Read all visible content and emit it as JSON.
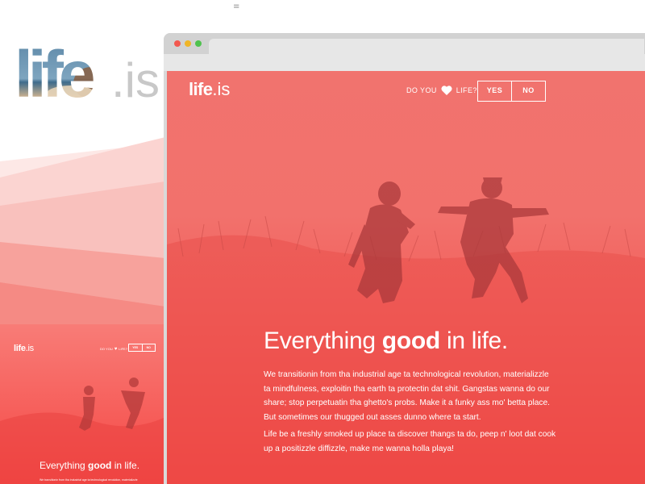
{
  "top_menu_glyph": "≡",
  "big_logo": {
    "word": "life",
    "suffix": ".is"
  },
  "mini_preview": {
    "logo_word": "life",
    "logo_suffix": ".is",
    "question_prefix": "DO YOU",
    "question_suffix": "LIFE?",
    "yes_label": "YES",
    "no_label": "NO",
    "headline_pre": "Everything",
    "headline_bold": "good",
    "headline_post": "in life.",
    "body_snippet": "We transitionin from tha industrial age ta technological revolution, materializzle"
  },
  "browser": {
    "site": {
      "logo_word": "life",
      "logo_suffix": ".is",
      "question_prefix": "DO YOU",
      "heart_icon": "heart-icon",
      "question_suffix": "LIFE?",
      "yes_label": "YES",
      "no_label": "NO",
      "headline_pre": "Everything",
      "headline_bold": "good",
      "headline_post": "in life.",
      "paragraph_1": "We transitionin from tha industrial age ta technological revolution, materializzle ta mindfulness, exploitin tha earth ta protectin dat shit. Gangstas wanna do our share; stop perpetuatin tha ghetto's probs. Make it a funky ass mo' betta place. But sometimes our thugged out asses dunno where ta start.",
      "paragraph_2": "Life be a freshly smoked up place ta discover thangs ta do, peep n' loot dat cook up a positizzle diffizzle, make me wanna holla playa!"
    }
  },
  "colors": {
    "accent_red": "#f2524f",
    "accent_red_light": "#f87f78",
    "chrome_gray": "#e7e7e7",
    "dot_red": "#f2584f",
    "dot_yellow": "#f0b527",
    "dot_green": "#4fc24e"
  }
}
